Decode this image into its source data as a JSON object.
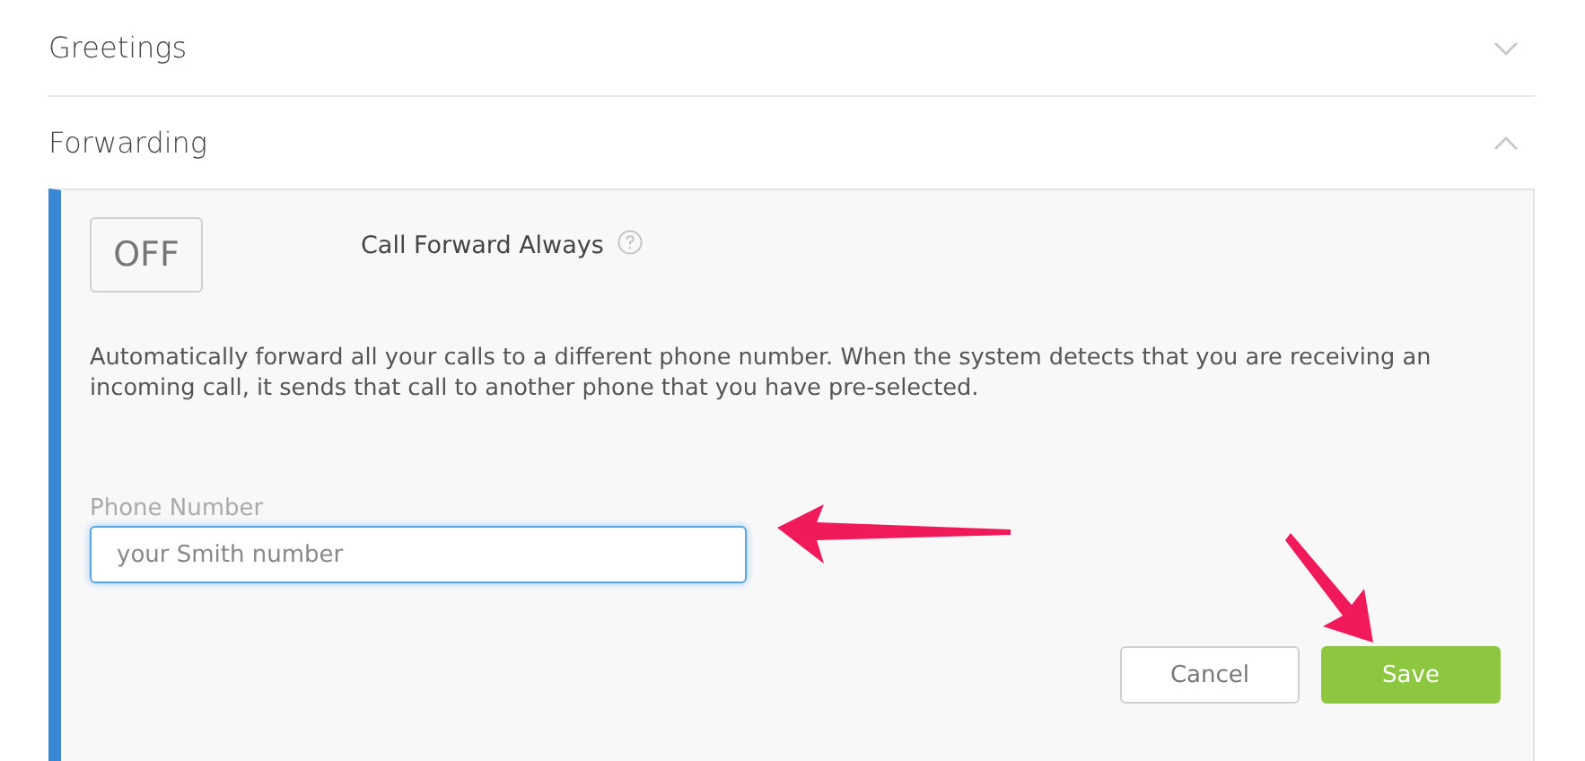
{
  "sections": [
    {
      "title": "Greetings",
      "expanded": false
    },
    {
      "title": "Forwarding",
      "expanded": true,
      "panel": {
        "toggle": {
          "label": "OFF",
          "on": false
        },
        "setting_label": "Call Forward Always",
        "description": "Automatically forward all your calls to a different phone number. When the system detects that you are receiving an incoming call, it sends that call to another phone that you have pre-selected.",
        "field": {
          "label": "Phone Number",
          "placeholder": "your Smith number"
        },
        "buttons": [
          {
            "label": "Cancel",
            "kind": "secondary"
          },
          {
            "label": "Save",
            "kind": "primary"
          }
        ]
      }
    }
  ]
}
